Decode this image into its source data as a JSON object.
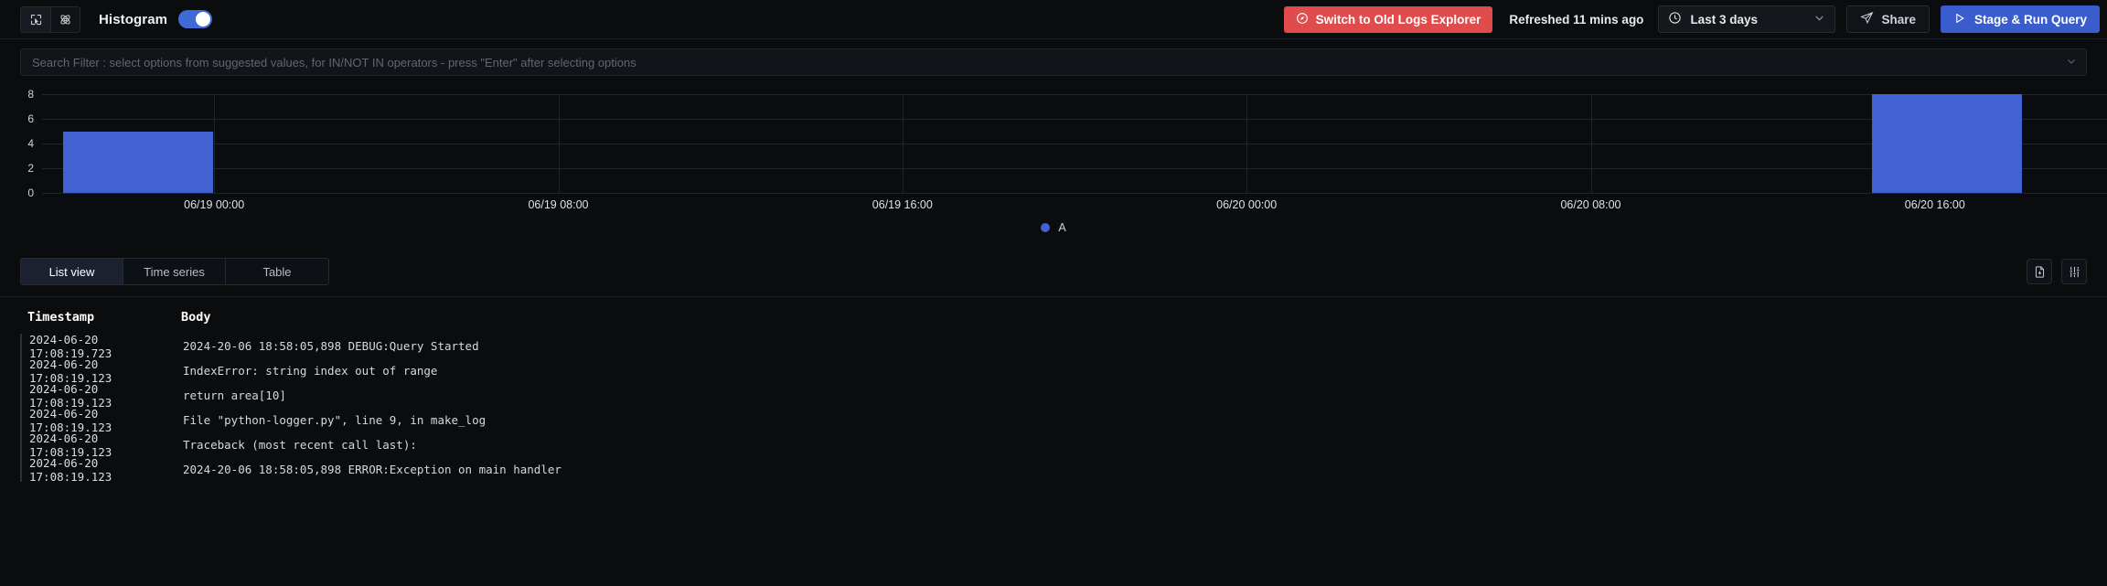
{
  "topbar": {
    "select_icon": "cursor-select-icon",
    "atom_icon": "atom-icon",
    "histogram_label": "Histogram",
    "histogram_toggle_on": true,
    "switch_button_label": "Switch to Old Logs Explorer",
    "switch_button_icon": "compass-icon",
    "switch_button_color": "#e04c4c",
    "refreshed_text": "Refreshed 11 mins ago",
    "time_range": "Last 3 days",
    "time_range_icon": "clock-icon",
    "time_range_chevron": "chevron-down-icon",
    "share_label": "Share",
    "share_icon": "send-icon",
    "run_label": "Stage & Run Query",
    "run_icon": "play-icon",
    "run_color": "#3a5ccc"
  },
  "search": {
    "placeholder": "Search Filter : select options from suggested values, for IN/NOT IN operators - press \"Enter\" after selecting options",
    "value": "",
    "chevron": "chevron-down-icon"
  },
  "chart_data": {
    "type": "bar",
    "title": "",
    "xlabel": "",
    "ylabel": "",
    "ylim": [
      0,
      8
    ],
    "yticks": [
      0,
      2,
      4,
      6,
      8
    ],
    "xticks": [
      "06/19 00:00",
      "06/19 08:00",
      "06/19 16:00",
      "06/20 00:00",
      "06/20 08:00",
      "06/20 16:00"
    ],
    "grid": true,
    "legend": [
      {
        "name": "A",
        "color": "#4162d0"
      }
    ],
    "legend_position": "bottom",
    "series": [
      {
        "name": "A",
        "color": "#4162d0",
        "bars": [
          {
            "x": "06/18 20:00",
            "value": 5,
            "left_pct": 1.0,
            "width_pct": 7.3
          },
          {
            "x": "06/20 16:00",
            "value": 8,
            "left_pct": 88.6,
            "width_pct": 7.3
          }
        ]
      }
    ]
  },
  "tabs": {
    "items": [
      {
        "label": "List view",
        "active": true
      },
      {
        "label": "Time series",
        "active": false
      },
      {
        "label": "Table",
        "active": false
      }
    ],
    "download_icon": "download-file-icon",
    "settings_icon": "sliders-icon"
  },
  "log_table": {
    "columns": [
      "Timestamp",
      "Body"
    ],
    "rows": [
      {
        "timestamp": "2024-06-20 17:08:19.723",
        "body": "2024-20-06 18:58:05,898 DEBUG:Query Started"
      },
      {
        "timestamp": "2024-06-20 17:08:19.123",
        "body": "IndexError: string index out of range"
      },
      {
        "timestamp": "2024-06-20 17:08:19.123",
        "body": "return area[10]"
      },
      {
        "timestamp": "2024-06-20 17:08:19.123",
        "body": "File \"python-logger.py\", line 9, in make_log"
      },
      {
        "timestamp": "2024-06-20 17:08:19.123",
        "body": "Traceback (most recent call last):"
      },
      {
        "timestamp": "2024-06-20 17:08:19.123",
        "body": "2024-20-06 18:58:05,898 ERROR:Exception on main handler"
      }
    ]
  }
}
